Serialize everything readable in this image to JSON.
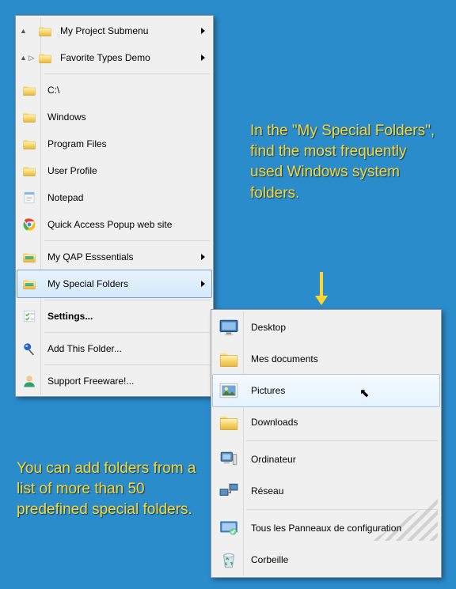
{
  "annotations": {
    "top": "In the \"My Special Folders\", find the most frequently used Windows system folders.",
    "bottom": "You can add folders from a list of more than 50 predefined special folders."
  },
  "menu": {
    "items": [
      {
        "label": "My Project Submenu",
        "kind": "tree-folder",
        "submenu": true,
        "expand": "▲"
      },
      {
        "label": "Favorite Types Demo",
        "kind": "tree-folder",
        "submenu": true,
        "expand": "▲ ▷"
      },
      {
        "sep": true
      },
      {
        "label": "C:\\",
        "kind": "folder"
      },
      {
        "label": "Windows",
        "kind": "folder"
      },
      {
        "label": "Program Files",
        "kind": "folder"
      },
      {
        "label": "User Profile",
        "kind": "folder"
      },
      {
        "label": "Notepad",
        "kind": "notepad"
      },
      {
        "label": "Quick Access Popup web site",
        "kind": "chrome"
      },
      {
        "sep": true
      },
      {
        "label": "My QAP Esssentials",
        "kind": "special-folder",
        "submenu": true
      },
      {
        "label": "My Special Folders",
        "kind": "special-folder",
        "submenu": true,
        "highlight": true
      },
      {
        "sep": true
      },
      {
        "label": "Settings...",
        "kind": "settings",
        "bold": true
      },
      {
        "sep": true
      },
      {
        "label": "Add This Folder...",
        "kind": "pin"
      },
      {
        "sep": true
      },
      {
        "label": "Support Freeware!...",
        "kind": "user"
      }
    ]
  },
  "submenu": {
    "items": [
      {
        "label": "Desktop",
        "kind": "desktop"
      },
      {
        "label": "Mes documents",
        "kind": "folder"
      },
      {
        "label": "Pictures",
        "kind": "pictures",
        "highlight": true
      },
      {
        "label": "Downloads",
        "kind": "folder"
      },
      {
        "sep": true
      },
      {
        "label": "Ordinateur",
        "kind": "computer"
      },
      {
        "label": "Réseau",
        "kind": "network"
      },
      {
        "sep": true
      },
      {
        "label": "Tous les Panneaux de configuration",
        "kind": "control-panel"
      },
      {
        "label": "Corbeille",
        "kind": "recycle"
      }
    ]
  }
}
